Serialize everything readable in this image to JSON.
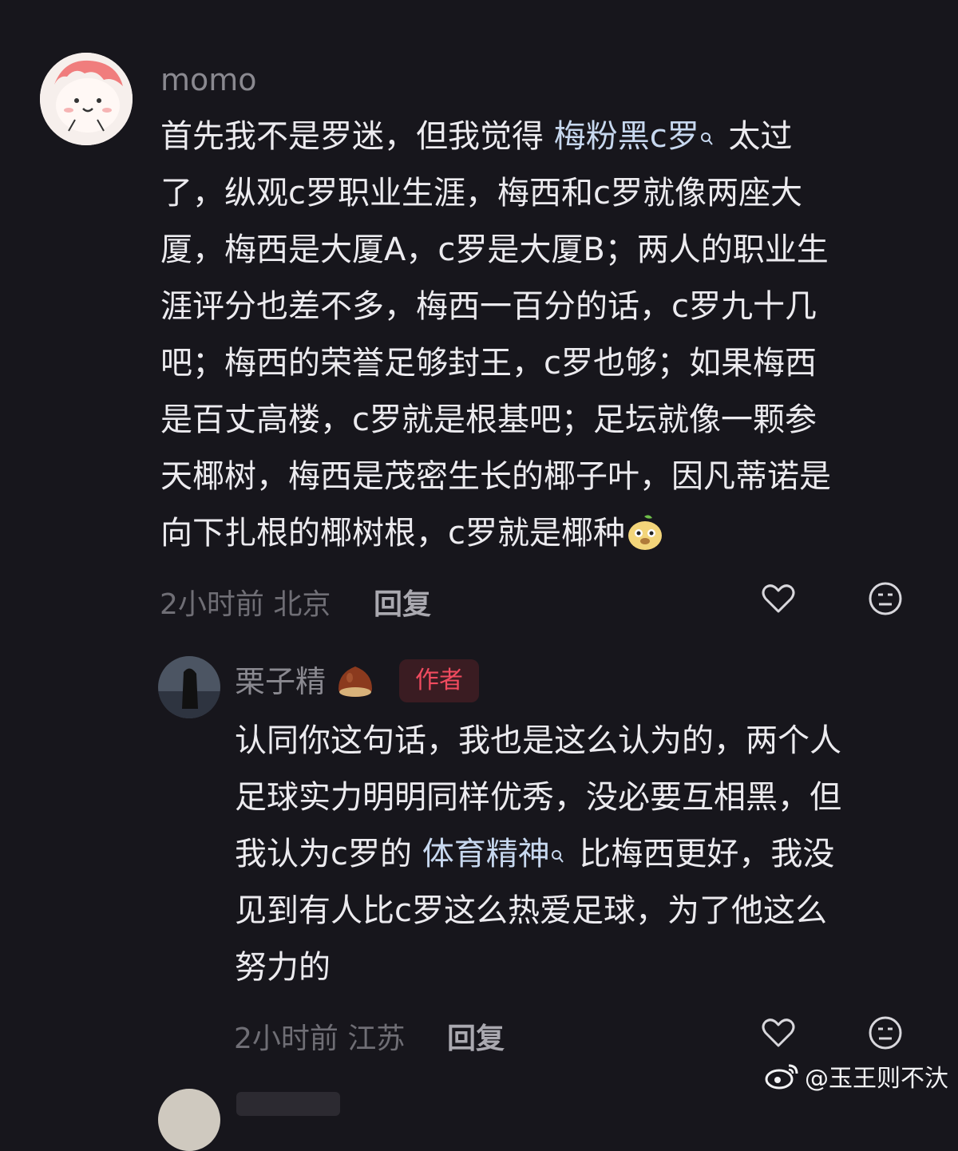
{
  "comment_1": {
    "username": "momo",
    "lines": [
      [
        "首先我不是罗迷，但我觉得 ",
        "梅粉黑c罗",
        " 太过"
      ],
      [
        "了，纵观c罗职业生涯，梅西和c罗就像两座大"
      ],
      [
        "厦，梅西是大厦A，c罗是大厦B；两人的职业生"
      ],
      [
        "涯评分也差不多，梅西一百分的话，c罗九十几"
      ],
      [
        "吧；梅西的荣誉足够封王，c罗也够；如果梅西"
      ],
      [
        "是百丈高楼，c罗就是根基吧；足坛就像一颗参"
      ],
      [
        "天椰树，梅西是茂密生长的椰子叶，因凡蒂诺是"
      ],
      [
        "向下扎根的椰树根，c罗就是椰种"
      ]
    ],
    "time": "2小时前 北京",
    "reply_label": "回复"
  },
  "comment_2": {
    "username": "栗子精",
    "author_badge": "作者",
    "lines": [
      [
        "认同你这句话，我也是这么认为的，两个人"
      ],
      [
        "足球实力明明同样优秀，没必要互相黑，但"
      ],
      [
        "我认为c罗的 ",
        "体育精神",
        " 比梅西更好，我没"
      ],
      [
        "见到有人比c罗这么热爱足球，为了他这么"
      ],
      [
        "努力的"
      ]
    ],
    "time": "2小时前 江苏",
    "reply_label": "回复"
  },
  "watermark": "@玉王则不汏",
  "colors": {
    "background": "#17161c",
    "link": "#c7d8ef",
    "author_badge_text": "#f14b5f",
    "author_badge_bg": "#3a1c22"
  },
  "icons": [
    "heart-outline-icon",
    "dislike-face-icon",
    "search-icon",
    "chestnut-emoji",
    "doge-sticker",
    "weibo-logo"
  ]
}
